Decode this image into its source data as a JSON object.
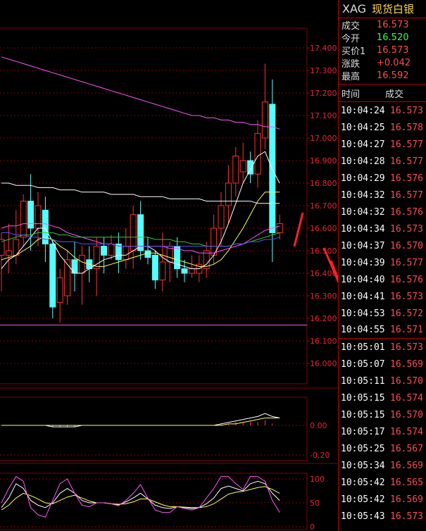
{
  "symbol": {
    "code": "XAG",
    "name": "现货白银"
  },
  "quotes": [
    {
      "label": "成交",
      "value": "16.573",
      "up": false
    },
    {
      "label": "今开",
      "value": "16.520",
      "up": true
    },
    {
      "label": "买价1",
      "value": "16.573",
      "up": false
    },
    {
      "label": "涨跌",
      "value": "+0.042",
      "up": false
    },
    {
      "label": "最高",
      "value": "16.592",
      "up": false
    }
  ],
  "trades_header": {
    "time": "时间",
    "price": "成交"
  },
  "trades": [
    {
      "time": "10:04:24",
      "price": "16.573"
    },
    {
      "time": "10:04:25",
      "price": "16.578"
    },
    {
      "time": "10:04:27",
      "price": "16.577"
    },
    {
      "time": "10:04:28",
      "price": "16.577"
    },
    {
      "time": "10:04:29",
      "price": "16.576"
    },
    {
      "time": "10:04:32",
      "price": "16.577"
    },
    {
      "time": "10:04:32",
      "price": "16.576"
    },
    {
      "time": "10:04:34",
      "price": "16.573"
    },
    {
      "time": "10:04:37",
      "price": "16.570"
    },
    {
      "time": "10:04:39",
      "price": "16.577"
    },
    {
      "time": "10:04:40",
      "price": "16.576"
    },
    {
      "time": "10:04:41",
      "price": "16.573"
    },
    {
      "time": "10:04:53",
      "price": "16.572"
    },
    {
      "time": "10:04:55",
      "price": "16.571"
    },
    {
      "time": "10:05:01",
      "price": "16.573"
    },
    {
      "time": "10:05:07",
      "price": "16.569"
    },
    {
      "time": "10:05:11",
      "price": "16.570"
    },
    {
      "time": "10:05:15",
      "price": "16.574"
    },
    {
      "time": "10:05:15",
      "price": "16.570"
    },
    {
      "time": "10:05:17",
      "price": "16.574"
    },
    {
      "time": "10:05:25",
      "price": "16.567"
    },
    {
      "time": "10:05:34",
      "price": "16.569"
    },
    {
      "time": "10:05:42",
      "price": "16.565"
    },
    {
      "time": "10:05:42",
      "price": "16.569"
    },
    {
      "time": "10:05:43",
      "price": "16.573"
    }
  ],
  "price_axis": [
    "17.400",
    "17.300",
    "17.200",
    "17.100",
    "17.000",
    "16.900",
    "16.800",
    "16.700",
    "16.600",
    "16.500",
    "16.400",
    "16.300",
    "16.200",
    "16.100",
    "16.000"
  ],
  "macd_axis": [
    "0.00",
    "-0.20"
  ],
  "kdj_axis": [
    "100",
    "50",
    "0"
  ],
  "colors": {
    "up": "#ff3030",
    "down": "#55ffff",
    "grid": "#8a0000",
    "ma5": "#ffffff",
    "ma10": "#ffff55",
    "ma20": "#ff55ff",
    "ma30": "#33cc33",
    "ma60": "#5555ff",
    "arrow": "#ff2020"
  },
  "chart_data": {
    "type": "candlestick",
    "price_ylim": [
      15.9,
      17.5
    ],
    "candles": [
      {
        "o": 16.48,
        "c": 16.55,
        "h": 16.58,
        "l": 16.32
      },
      {
        "o": 16.48,
        "c": 16.5,
        "h": 16.62,
        "l": 16.4
      },
      {
        "o": 16.48,
        "c": 16.55,
        "h": 16.68,
        "l": 16.44
      },
      {
        "o": 16.56,
        "c": 16.72,
        "h": 16.75,
        "l": 16.52
      },
      {
        "o": 16.72,
        "c": 16.6,
        "h": 16.84,
        "l": 16.5
      },
      {
        "o": 16.6,
        "c": 16.7,
        "h": 16.76,
        "l": 16.52
      },
      {
        "o": 16.68,
        "c": 16.53,
        "h": 16.74,
        "l": 16.45
      },
      {
        "o": 16.53,
        "c": 16.25,
        "h": 16.55,
        "l": 16.2
      },
      {
        "o": 16.27,
        "c": 16.38,
        "h": 16.42,
        "l": 16.18
      },
      {
        "o": 16.3,
        "c": 16.46,
        "h": 16.5,
        "l": 16.26
      },
      {
        "o": 16.46,
        "c": 16.4,
        "h": 16.54,
        "l": 16.32
      },
      {
        "o": 16.4,
        "c": 16.48,
        "h": 16.52,
        "l": 16.26
      },
      {
        "o": 16.46,
        "c": 16.42,
        "h": 16.52,
        "l": 16.36
      },
      {
        "o": 16.42,
        "c": 16.52,
        "h": 16.56,
        "l": 16.3
      },
      {
        "o": 16.52,
        "c": 16.48,
        "h": 16.56,
        "l": 16.4
      },
      {
        "o": 16.48,
        "c": 16.53,
        "h": 16.57,
        "l": 16.46
      },
      {
        "o": 16.53,
        "c": 16.46,
        "h": 16.58,
        "l": 16.4
      },
      {
        "o": 16.46,
        "c": 16.52,
        "h": 16.6,
        "l": 16.42
      },
      {
        "o": 16.5,
        "c": 16.66,
        "h": 16.7,
        "l": 16.42
      },
      {
        "o": 16.66,
        "c": 16.5,
        "h": 16.72,
        "l": 16.46
      },
      {
        "o": 16.5,
        "c": 16.47,
        "h": 16.56,
        "l": 16.44
      },
      {
        "o": 16.48,
        "c": 16.37,
        "h": 16.5,
        "l": 16.33
      },
      {
        "o": 16.37,
        "c": 16.45,
        "h": 16.58,
        "l": 16.32
      },
      {
        "o": 16.45,
        "c": 16.52,
        "h": 16.54,
        "l": 16.36
      },
      {
        "o": 16.52,
        "c": 16.42,
        "h": 16.56,
        "l": 16.38
      },
      {
        "o": 16.42,
        "c": 16.4,
        "h": 16.46,
        "l": 16.36
      },
      {
        "o": 16.4,
        "c": 16.42,
        "h": 16.48,
        "l": 16.38
      },
      {
        "o": 16.4,
        "c": 16.44,
        "h": 16.48,
        "l": 16.36
      },
      {
        "o": 16.42,
        "c": 16.5,
        "h": 16.54,
        "l": 16.38
      },
      {
        "o": 16.48,
        "c": 16.6,
        "h": 16.66,
        "l": 16.44
      },
      {
        "o": 16.6,
        "c": 16.7,
        "h": 16.76,
        "l": 16.52
      },
      {
        "o": 16.7,
        "c": 16.8,
        "h": 16.88,
        "l": 16.62
      },
      {
        "o": 16.8,
        "c": 16.92,
        "h": 16.96,
        "l": 16.74
      },
      {
        "o": 16.85,
        "c": 16.9,
        "h": 16.98,
        "l": 16.8
      },
      {
        "o": 16.9,
        "c": 16.84,
        "h": 16.94,
        "l": 16.8
      },
      {
        "o": 16.84,
        "c": 17.02,
        "h": 17.08,
        "l": 16.78
      },
      {
        "o": 17.0,
        "c": 17.16,
        "h": 17.33,
        "l": 16.95
      },
      {
        "o": 17.15,
        "c": 16.58,
        "h": 17.26,
        "l": 16.45
      },
      {
        "o": 16.58,
        "c": 16.62,
        "h": 16.66,
        "l": 16.55
      }
    ],
    "ma_lines": [
      {
        "name": "ma5",
        "color_key": "ma5",
        "values": [
          16.42,
          16.46,
          16.48,
          16.52,
          16.56,
          16.6,
          16.6,
          16.54,
          16.48,
          16.44,
          16.4,
          16.4,
          16.42,
          16.44,
          16.46,
          16.47,
          16.48,
          16.48,
          16.5,
          16.52,
          16.52,
          16.5,
          16.47,
          16.45,
          16.44,
          16.43,
          16.42,
          16.42,
          16.44,
          16.48,
          16.54,
          16.62,
          16.71,
          16.8,
          16.86,
          16.92,
          16.94,
          16.86,
          16.8
        ]
      },
      {
        "name": "ma10",
        "color_key": "ma10",
        "values": [
          16.46,
          16.47,
          16.48,
          16.5,
          16.52,
          16.55,
          16.56,
          16.55,
          16.52,
          16.5,
          16.47,
          16.45,
          16.44,
          16.43,
          16.43,
          16.44,
          16.45,
          16.46,
          16.47,
          16.48,
          16.49,
          16.49,
          16.48,
          16.47,
          16.46,
          16.45,
          16.44,
          16.43,
          16.43,
          16.44,
          16.46,
          16.5,
          16.55,
          16.6,
          16.66,
          16.72,
          16.76,
          16.76,
          16.76
        ]
      },
      {
        "name": "ma20",
        "color_key": "ma20",
        "values": [
          16.6,
          16.61,
          16.61,
          16.62,
          16.62,
          16.62,
          16.62,
          16.61,
          16.6,
          16.58,
          16.57,
          16.56,
          16.55,
          16.54,
          16.53,
          16.53,
          16.52,
          16.52,
          16.52,
          16.52,
          16.52,
          16.52,
          16.52,
          16.51,
          16.51,
          16.5,
          16.5,
          16.49,
          16.49,
          16.49,
          16.5,
          16.51,
          16.52,
          16.53,
          16.55,
          16.57,
          16.59,
          16.6,
          16.61
        ]
      },
      {
        "name": "ma30",
        "color_key": "ma30",
        "values": [
          16.54,
          16.55,
          16.56,
          16.57,
          16.57,
          16.58,
          16.58,
          16.58,
          16.57,
          16.57,
          16.56,
          16.56,
          16.56,
          16.56,
          16.56,
          16.56,
          16.56,
          16.56,
          16.56,
          16.56,
          16.56,
          16.55,
          16.55,
          16.55,
          16.54,
          16.54,
          16.53,
          16.53,
          16.52,
          16.52,
          16.52,
          16.52,
          16.53,
          16.53,
          16.54,
          16.55,
          16.56,
          16.57,
          16.58
        ]
      },
      {
        "name": "ma60",
        "color_key": "ma60",
        "values": [
          16.58,
          16.58,
          16.57,
          16.57,
          16.56,
          16.56,
          16.55,
          16.55,
          16.54,
          16.54,
          16.54,
          16.53,
          16.53,
          16.53,
          16.53,
          16.53,
          16.52,
          16.52,
          16.52,
          16.52,
          16.52,
          16.52,
          16.52,
          16.52,
          16.52,
          16.52,
          16.52,
          16.52,
          16.52,
          16.52,
          16.52,
          16.52,
          16.53,
          16.53,
          16.54,
          16.54,
          16.55,
          16.55,
          16.56
        ]
      },
      {
        "name": "ma120",
        "color_key": "ma20",
        "values": [
          17.36,
          17.35,
          17.34,
          17.33,
          17.32,
          17.31,
          17.3,
          17.29,
          17.28,
          17.27,
          17.26,
          17.25,
          17.24,
          17.23,
          17.22,
          17.21,
          17.2,
          17.19,
          17.18,
          17.17,
          17.16,
          17.15,
          17.14,
          17.13,
          17.12,
          17.11,
          17.1,
          17.1,
          17.09,
          17.09,
          17.08,
          17.08,
          17.07,
          17.07,
          17.06,
          17.06,
          17.05,
          17.05,
          17.04
        ]
      },
      {
        "name": "ma240",
        "color_key": "ma5",
        "values": [
          16.8,
          16.8,
          16.79,
          16.79,
          16.79,
          16.78,
          16.78,
          16.78,
          16.77,
          16.77,
          16.77,
          16.76,
          16.76,
          16.76,
          16.76,
          16.75,
          16.75,
          16.75,
          16.75,
          16.74,
          16.74,
          16.74,
          16.74,
          16.73,
          16.73,
          16.73,
          16.73,
          16.73,
          16.72,
          16.72,
          16.72,
          16.72,
          16.72,
          16.72,
          16.72,
          16.71,
          16.71,
          16.71,
          16.71
        ]
      }
    ],
    "macd": {
      "ylim": [
        -0.22,
        0.12
      ],
      "dif": [
        0.0,
        0.0,
        0.0,
        0.0,
        0.0,
        0.0,
        0.0,
        -0.01,
        -0.01,
        -0.01,
        -0.01,
        0.0,
        0.0,
        0.0,
        0.0,
        0.0,
        0.0,
        0.0,
        0.0,
        0.0,
        0.0,
        0.0,
        0.0,
        0.0,
        0.0,
        0.0,
        0.0,
        0.0,
        0.0,
        0.0,
        0.01,
        0.02,
        0.03,
        0.04,
        0.05,
        0.06,
        0.08,
        0.06,
        0.05
      ],
      "dea": [
        0.0,
        0.0,
        0.0,
        0.0,
        0.0,
        0.0,
        0.0,
        0.0,
        0.0,
        0.0,
        0.0,
        0.0,
        0.0,
        0.0,
        0.0,
        0.0,
        0.0,
        0.0,
        0.0,
        0.0,
        0.0,
        0.0,
        0.0,
        0.0,
        0.0,
        0.0,
        0.0,
        0.0,
        0.0,
        0.0,
        0.0,
        0.01,
        0.01,
        0.02,
        0.03,
        0.04,
        0.05,
        0.05,
        0.05
      ]
    },
    "kdj": {
      "ylim": [
        0,
        100
      ],
      "k": [
        40,
        60,
        90,
        80,
        55,
        45,
        40,
        50,
        70,
        80,
        70,
        55,
        50,
        50,
        50,
        48,
        46,
        52,
        60,
        70,
        58,
        45,
        40,
        38,
        42,
        40,
        38,
        40,
        48,
        60,
        80,
        85,
        80,
        75,
        90,
        95,
        90,
        70,
        55
      ],
      "d": [
        35,
        45,
        60,
        70,
        65,
        58,
        50,
        48,
        55,
        62,
        66,
        60,
        54,
        50,
        50,
        48,
        47,
        48,
        52,
        58,
        58,
        52,
        46,
        42,
        42,
        41,
        40,
        40,
        42,
        48,
        58,
        68,
        72,
        74,
        78,
        82,
        84,
        78,
        70
      ],
      "j": [
        50,
        80,
        120,
        95,
        40,
        25,
        20,
        55,
        90,
        100,
        70,
        45,
        42,
        50,
        50,
        48,
        44,
        55,
        70,
        88,
        60,
        35,
        30,
        30,
        42,
        38,
        35,
        40,
        60,
        80,
        110,
        105,
        90,
        78,
        105,
        105,
        95,
        55,
        30
      ]
    }
  }
}
